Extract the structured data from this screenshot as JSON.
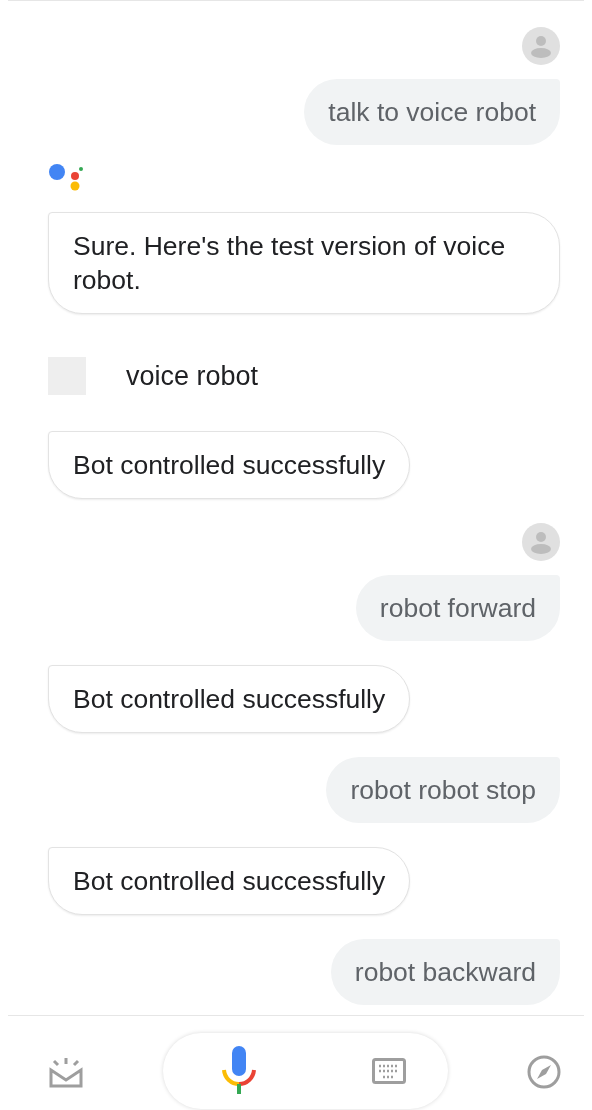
{
  "messages": [
    {
      "kind": "user",
      "text": "talk to voice robot",
      "show_avatar": true
    },
    {
      "kind": "bot",
      "text": "Sure. Here's the test version of voice robot.",
      "show_logo": true
    },
    {
      "kind": "app",
      "text": "voice robot"
    },
    {
      "kind": "bot",
      "text": "Bot controlled successfully",
      "show_logo": false
    },
    {
      "kind": "user",
      "text": "robot forward",
      "show_avatar": true
    },
    {
      "kind": "bot",
      "text": "Bot controlled successfully",
      "show_logo": false
    },
    {
      "kind": "user",
      "text": "robot robot stop",
      "show_avatar": false
    },
    {
      "kind": "bot",
      "text": "Bot controlled successfully",
      "show_logo": false
    },
    {
      "kind": "user",
      "text": "robot backward",
      "show_avatar": false
    }
  ]
}
